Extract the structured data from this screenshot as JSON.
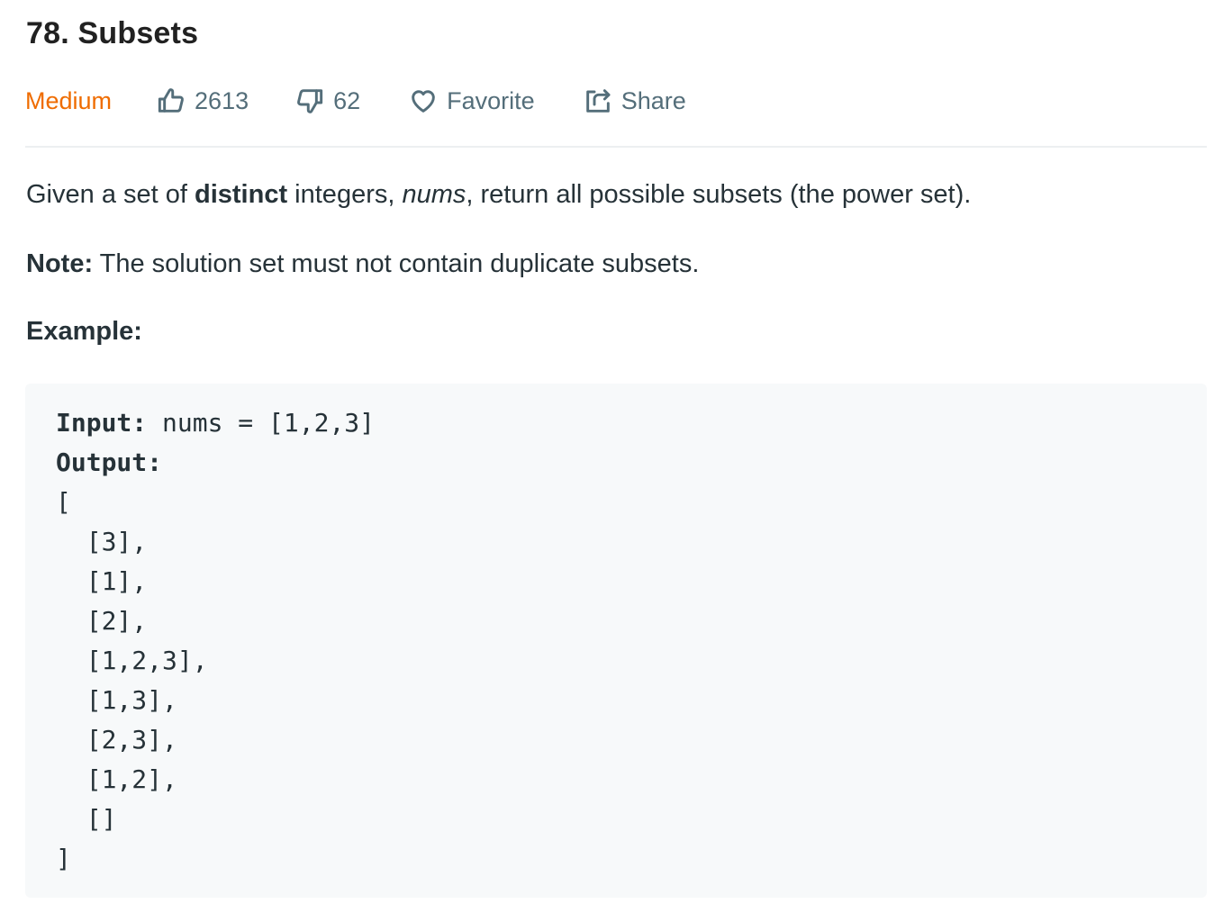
{
  "problem": {
    "title": "78. Subsets",
    "difficulty": "Medium",
    "likes": "2613",
    "dislikes": "62",
    "favorite_label": "Favorite",
    "share_label": "Share"
  },
  "description": {
    "p1_before": "Given a set of ",
    "p1_bold": "distinct",
    "p1_mid": " integers, ",
    "p1_italic": "nums",
    "p1_after": ", return all possible subsets (the power set).",
    "note_label": "Note:",
    "note_text": " The solution set must not contain duplicate subsets.",
    "example_label": "Example:"
  },
  "example": {
    "input_label": "Input:",
    "input_value": " nums = [1,2,3]",
    "output_label": "Output:",
    "output_lines": [
      "[",
      "  [3],",
      "  [1],",
      "  [2],",
      "  [1,2,3],",
      "  [1,3],",
      "  [2,3],",
      "  [1,2],",
      "  []",
      "]"
    ]
  },
  "colors": {
    "difficulty_medium": "#ef6c00",
    "meta_text": "#546e7a",
    "code_background": "#f7f9fa",
    "divider": "#eceff1"
  },
  "icons": [
    "thumbs-up-icon",
    "thumbs-down-icon",
    "heart-icon",
    "share-icon"
  ]
}
